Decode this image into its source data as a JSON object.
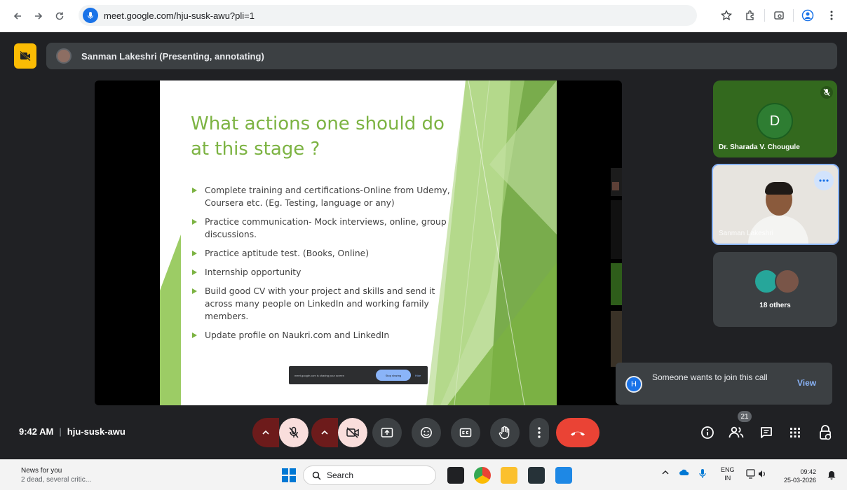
{
  "browser": {
    "url": "meet.google.com/hju-susk-awu?pli=1"
  },
  "presenter_bar": {
    "label": "Sanman Lakeshri (Presenting, annotating)"
  },
  "slide": {
    "title": "What actions one should do at this stage ?",
    "bullets": [
      "Complete training and certifications-Online from Udemy, Coursera etc. (Eg. Testing, language or any)",
      "Practice communication- Mock interviews, online, group discussions.",
      "Practice aptitude test. (Books, Online)",
      "Internship opportunity",
      "Build good CV with your project and skills and send it across many people on LinkedIn and working family members.",
      "Update profile on Naukri.com and LinkedIn"
    ],
    "share_notice": {
      "text": "meet.google.com is sharing your screen",
      "stop_label": "Stop sharing",
      "hide_label": "Hide"
    }
  },
  "participants": {
    "tile1": {
      "initial": "D",
      "name": "Dr. Sharada V. Chougule"
    },
    "tile2": {
      "name": "Sanman Lakeshri"
    },
    "tile3": {
      "label": "18 others"
    }
  },
  "toast": {
    "initial": "H",
    "message": "Someone wants to join this call",
    "action": "View"
  },
  "meeting": {
    "time": "9:42 AM",
    "separator": "|",
    "code": "hju-susk-awu",
    "participant_count": "21"
  },
  "taskbar": {
    "news_title": "News for you",
    "news_sub": "2 dead, several critic...",
    "search_label": "Search",
    "lang_top": "ENG",
    "lang_bottom": "IN",
    "clock_time": "09:42",
    "clock_date": "25-03-2026"
  },
  "colors": {
    "meet_bg": "#202124",
    "slide_green": "#7cb342",
    "end_call": "#ea4335",
    "muted_bg": "#f9dedc",
    "accent_blue": "#8ab4f8"
  }
}
